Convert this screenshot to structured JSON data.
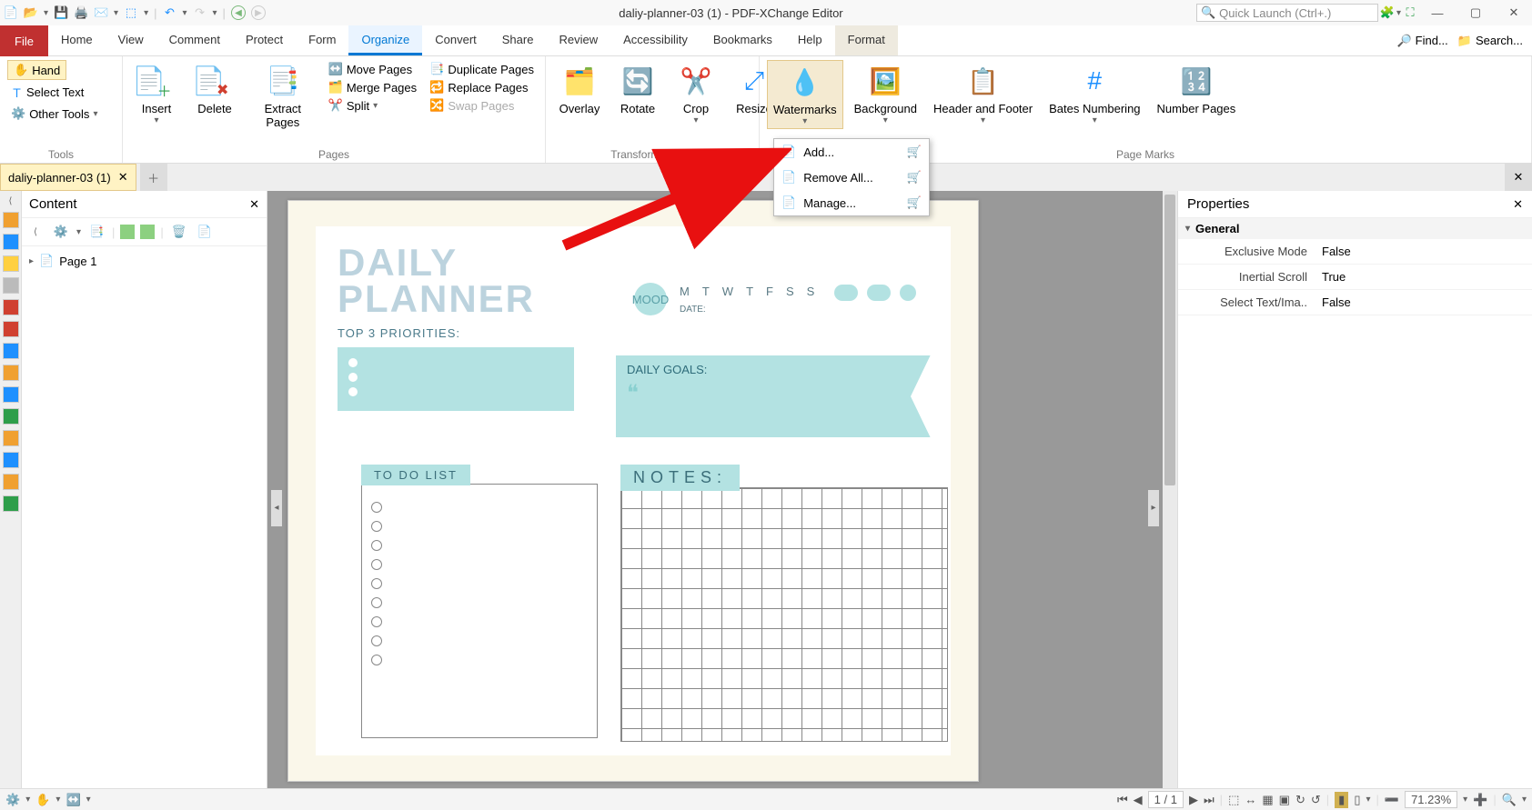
{
  "app": {
    "title": "daliy-planner-03 (1) - PDF-XChange Editor",
    "quick_launch_placeholder": "Quick Launch (Ctrl+.)"
  },
  "menubar": {
    "file": "File",
    "items": [
      "Home",
      "View",
      "Comment",
      "Protect",
      "Form",
      "Organize",
      "Convert",
      "Share",
      "Review",
      "Accessibility",
      "Bookmarks",
      "Help",
      "Format"
    ],
    "active": "Organize",
    "find": "Find...",
    "search": "Search..."
  },
  "ribbon": {
    "tools": {
      "label": "Tools",
      "hand": "Hand",
      "select_text": "Select Text",
      "other_tools": "Other Tools"
    },
    "pages": {
      "label": "Pages",
      "insert": "Insert",
      "delete": "Delete",
      "extract": "Extract Pages",
      "move": "Move Pages",
      "merge": "Merge Pages",
      "split": "Split",
      "duplicate": "Duplicate Pages",
      "replace": "Replace Pages",
      "swap": "Swap Pages"
    },
    "transform": {
      "label": "Transform Pages",
      "overlay": "Overlay",
      "rotate": "Rotate",
      "crop": "Crop",
      "resize": "Resize"
    },
    "pagemarks": {
      "label": "Page Marks",
      "watermarks": "Watermarks",
      "background": "Background",
      "header_footer": "Header and Footer",
      "bates": "Bates Numbering",
      "number_pages": "Number Pages"
    }
  },
  "watermarks_menu": {
    "add": "Add...",
    "remove_all": "Remove All...",
    "manage": "Manage..."
  },
  "doc_tab": {
    "name": "daliy-planner-03 (1)"
  },
  "content_panel": {
    "title": "Content",
    "page1": "Page 1"
  },
  "properties": {
    "title": "Properties",
    "section": "General",
    "rows": [
      {
        "k": "Exclusive Mode",
        "v": "False"
      },
      {
        "k": "Inertial Scroll",
        "v": "True"
      },
      {
        "k": "Select Text/Ima..",
        "v": "False"
      }
    ]
  },
  "page": {
    "daily": "DAILY",
    "planner": "PLANNER",
    "top3": "TOP 3 PRIORITIES:",
    "goals": "DAILY GOALS:",
    "mood": "MOOD",
    "days": [
      "M",
      "T",
      "W",
      "T",
      "F",
      "S",
      "S"
    ],
    "date": "DATE:",
    "todo": "TO DO LIST",
    "notes": "NOTES:"
  },
  "status": {
    "page": "1 / 1",
    "zoom": "71.23%"
  }
}
